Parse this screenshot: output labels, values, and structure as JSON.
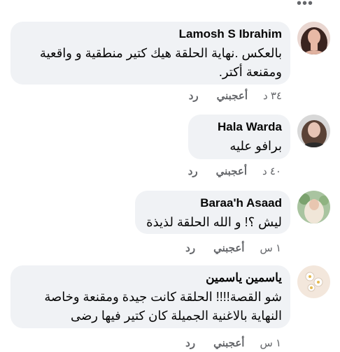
{
  "comments": [
    {
      "author": "Lamosh S Ibrahim",
      "text": "بالعكس .نهاية الحلقة هيك كتير منطقية و واقعية ومقنعة أكتر.",
      "time": "٣٤ د",
      "like": "أعجبني",
      "reply": "رد"
    },
    {
      "author": "Hala Warda",
      "text": "برافو عليه",
      "time": "٤٠ د",
      "like": "أعجبني",
      "reply": "رد"
    },
    {
      "author": "Baraa'h Asaad",
      "text": "ليش ؟! و الله الحلقة لذيذة",
      "time": "١ س",
      "like": "أعجبني",
      "reply": "رد"
    },
    {
      "author": "ياسمين ياسمين",
      "text": "شو القصة!!!! الحلقة كانت جيدة ومقنعة وخاصة النهاية  بالاغنية الجميلة كان كتير فيها رضى",
      "time": "١ س",
      "like": "أعجبني",
      "reply": "رد"
    }
  ],
  "menu_icon": "more-dots-icon"
}
